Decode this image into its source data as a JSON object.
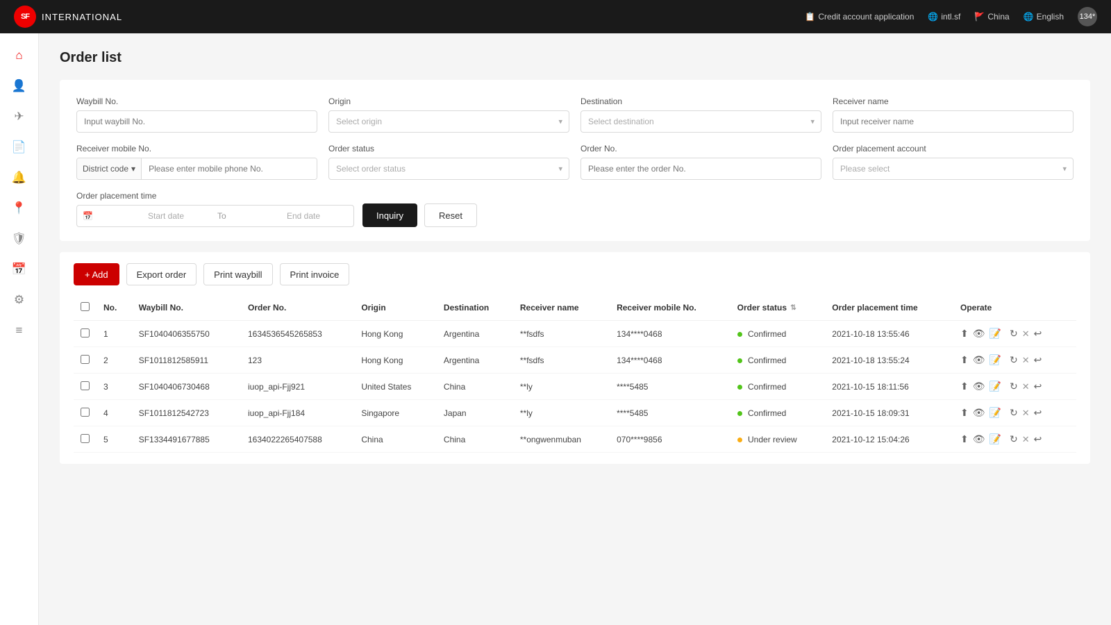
{
  "topnav": {
    "logo_text": "SF",
    "brand": "INTERNATIONAL",
    "links": [
      {
        "label": "Credit account application",
        "icon": "📋"
      },
      {
        "label": "intl.sf",
        "icon": "🌐"
      },
      {
        "label": "China",
        "icon": "🚩"
      },
      {
        "label": "English",
        "icon": "🌐"
      },
      {
        "label": "134*",
        "is_avatar": true
      }
    ]
  },
  "sidebar": {
    "items": [
      {
        "icon": "⌂",
        "name": "home"
      },
      {
        "icon": "👤",
        "name": "user"
      },
      {
        "icon": "✈",
        "name": "shipping"
      },
      {
        "icon": "📄",
        "name": "document"
      },
      {
        "icon": "🔔",
        "name": "notification"
      },
      {
        "icon": "📍",
        "name": "location"
      },
      {
        "icon": "🛡",
        "name": "security"
      },
      {
        "icon": "📅",
        "name": "calendar"
      },
      {
        "icon": "⚙",
        "name": "settings"
      },
      {
        "icon": "≡",
        "name": "menu"
      }
    ]
  },
  "page": {
    "title": "Order list"
  },
  "filters": {
    "waybill_no": {
      "label": "Waybill No.",
      "placeholder": "Input waybill No."
    },
    "origin": {
      "label": "Origin",
      "placeholder": "Select origin"
    },
    "destination": {
      "label": "Destination",
      "placeholder": "Select destination"
    },
    "receiver_name": {
      "label": "Receiver name",
      "placeholder": "Input receiver name"
    },
    "receiver_mobile": {
      "label": "Receiver mobile No.",
      "district_placeholder": "District code",
      "mobile_placeholder": "Please enter mobile phone No."
    },
    "order_status": {
      "label": "Order status",
      "placeholder": "Select order status"
    },
    "order_no": {
      "label": "Order No.",
      "placeholder": "Please enter the order No."
    },
    "order_placement_account": {
      "label": "Order placement account",
      "placeholder": "Please select"
    },
    "order_placement_time": {
      "label": "Order placement time",
      "start_placeholder": "Start date",
      "end_placeholder": "End date",
      "separator": "To"
    },
    "inquiry_btn": "Inquiry",
    "reset_btn": "Reset"
  },
  "toolbar": {
    "add_btn": "+ Add",
    "export_btn": "Export order",
    "print_waybill_btn": "Print waybill",
    "print_invoice_btn": "Print invoice"
  },
  "table": {
    "columns": [
      {
        "key": "no",
        "label": "No."
      },
      {
        "key": "waybill_no",
        "label": "Waybill No."
      },
      {
        "key": "order_no",
        "label": "Order No."
      },
      {
        "key": "origin",
        "label": "Origin"
      },
      {
        "key": "destination",
        "label": "Destination"
      },
      {
        "key": "receiver_name",
        "label": "Receiver name"
      },
      {
        "key": "receiver_mobile",
        "label": "Receiver mobile No."
      },
      {
        "key": "order_status",
        "label": "Order status"
      },
      {
        "key": "order_placement_time",
        "label": "Order placement time"
      },
      {
        "key": "operate",
        "label": "Operate"
      }
    ],
    "rows": [
      {
        "no": 1,
        "waybill_no": "SF1040406355750",
        "order_no": "1634536545265853",
        "origin": "Hong Kong",
        "destination": "Argentina",
        "receiver_name": "**fsdfs",
        "receiver_mobile": "134****0468",
        "order_status": "Confirmed",
        "status_type": "confirmed",
        "order_placement_time": "2021-10-18 13:55:46"
      },
      {
        "no": 2,
        "waybill_no": "SF1011812585911",
        "order_no": "123",
        "origin": "Hong Kong",
        "destination": "Argentina",
        "receiver_name": "**fsdfs",
        "receiver_mobile": "134****0468",
        "order_status": "Confirmed",
        "status_type": "confirmed",
        "order_placement_time": "2021-10-18 13:55:24"
      },
      {
        "no": 3,
        "waybill_no": "SF1040406730468",
        "order_no": "iuop_api-Fjj921",
        "origin": "United States",
        "destination": "China",
        "receiver_name": "**ly",
        "receiver_mobile": "****5485",
        "order_status": "Confirmed",
        "status_type": "confirmed",
        "order_placement_time": "2021-10-15 18:11:56"
      },
      {
        "no": 4,
        "waybill_no": "SF1011812542723",
        "order_no": "iuop_api-Fjj184",
        "origin": "Singapore",
        "destination": "Japan",
        "receiver_name": "**ly",
        "receiver_mobile": "****5485",
        "order_status": "Confirmed",
        "status_type": "confirmed",
        "order_placement_time": "2021-10-15 18:09:31"
      },
      {
        "no": 5,
        "waybill_no": "SF1334491677885",
        "order_no": "1634022265407588",
        "origin": "China",
        "destination": "China",
        "receiver_name": "**ongwenmuban",
        "receiver_mobile": "070****9856",
        "order_status": "Under review",
        "status_type": "under-review",
        "order_placement_time": "2021-10-12 15:04:26"
      }
    ]
  }
}
